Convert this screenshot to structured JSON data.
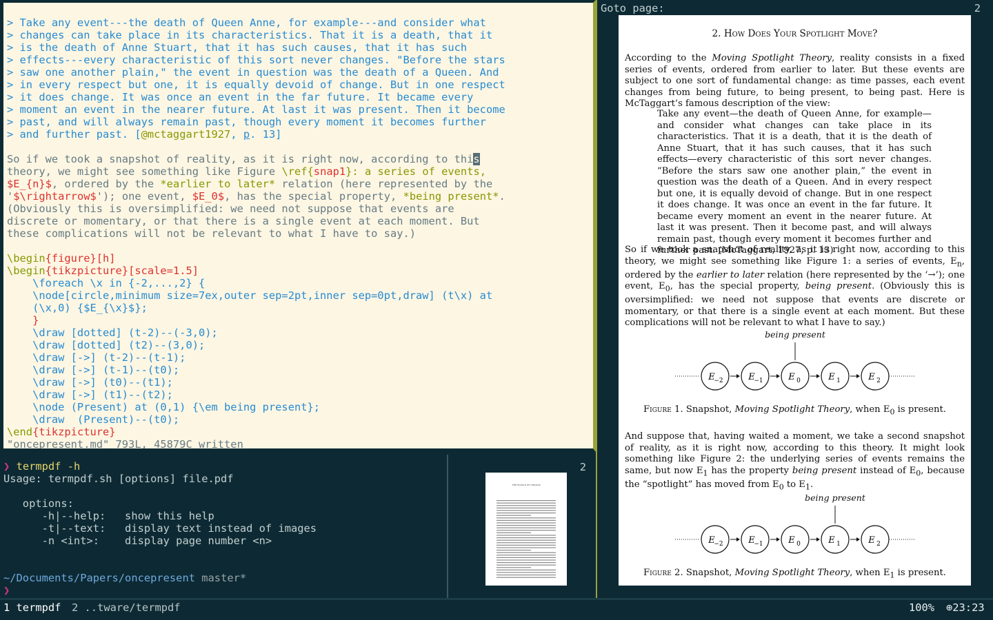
{
  "editor": {
    "quote_lines": [
      "> Take any event---the death of Queen Anne, for example---and consider what",
      "> changes can take place in its characteristics. That it is a death, that it",
      "> is the death of Anne Stuart, that it has such causes, that it has such",
      "> effects---every characteristic of this sort never changes. \"Before the stars",
      "> saw one another plain,\" the event in question was the death of a Queen. And",
      "> in every respect but one, it is equally devoid of change. But in one respect",
      "> it does change. It was once an event in the far future. It became every",
      "> moment an event in the nearer future. At last it was present. Then it become",
      "> past, and will always remain past, though every moment it becomes further"
    ],
    "quote_last_pre": "> and further past. [",
    "quote_last_cite": "@mctaggart1927",
    "quote_last_mid": ", ",
    "quote_last_p": "p",
    "quote_last_post": ". 13]",
    "para1_pre": "So if we took a snapshot of reality, as it is right now, according to thi",
    "para1_cursor": "s",
    "para2_a": "theory, we might see something like Figure ",
    "para2_ref": "\\ref",
    "para2_b": "{",
    "para2_c": "snap1",
    "para2_d": "}: a series of events,",
    "para3_math": "$E_{n}$",
    "para3_a": ", ordered by the ",
    "para3_em": "*earlier to later*",
    "para3_b": " relation (here represented by the",
    "para4_a": "'",
    "para4_math": "$\\rightarrow$",
    "para4_b": "'); one event, ",
    "para4_math2": "$E_0$",
    "para4_c": ", has the special property, ",
    "para4_em": "*being present*",
    "para4_d": ".",
    "para5": "(Obviously this is oversimplified: we need not suppose that events are",
    "para6": "discrete or momentary, or that there is a single event at each moment. But",
    "para7": "these complications will not be relevant to what I have to say.)",
    "begin_figure_cmd": "\\begin",
    "begin_figure_arg": "{figure}",
    "begin_figure_opt": "[h]",
    "begin_tikz_cmd": "\\begin",
    "begin_tikz_arg": "{tikzpicture}",
    "begin_tikz_opt": "[scale=1.5]",
    "foreach_line": "    \\foreach \\x in {-2,...,2} {",
    "node_line": "    \\node[circle,minimum size=7ex,outer sep=2pt,inner sep=0pt,draw] (t\\x) at",
    "node_line2": "    (\\x,0) {$E_{\\x}$};",
    "close_brace": "    }",
    "draw_lines": [
      "    \\draw [dotted] (t-2)--(-3,0);",
      "    \\draw [dotted] (t2)--(3,0);",
      "    \\draw [->] (t-2)--(t-1);",
      "    \\draw [->] (t-1)--(t0);",
      "    \\draw [->] (t0)--(t1);",
      "    \\draw [->] (t1)--(t2);",
      "    \\node (Present) at (0,1) {\\em being present};",
      "    \\draw  (Present)--(t0);"
    ],
    "end_tikz_cmd": "\\end",
    "end_tikz_arg": "{tikzpicture}",
    "status_line": "\"oncepresent.md\" 793L, 45879C written"
  },
  "shell": {
    "prompt_symbol": "❯",
    "command": "termpdf -h",
    "usage": "Usage: termpdf.sh [options] file.pdf",
    "options_header": "   options:",
    "options": [
      "      -h|--help:   show this help",
      "      -t|--text:   display text instead of images",
      "      -n <int>:    display page number <n>"
    ],
    "cwd": "~/Documents/Papers/oncepresent",
    "branch": "master*",
    "prompt2": "❯"
  },
  "thumb_pane": {
    "page_number": "2",
    "thumb_title": "THE PUZZLE OF CHANGE"
  },
  "pdf_viewer": {
    "goto_label": "Goto page:",
    "page_number": "2",
    "section_title": "2. How Does Your Spotlight Move?",
    "intro_a": "According to the ",
    "intro_em": "Moving Spotlight Theory",
    "intro_b": ", reality consists in a fixed series of events, ordered from earlier to later. But these events are subject to one sort of fundamental change: as time passes, each event changes from being future, to being present, to being past. Here is McTaggart’s famous description of the view:",
    "blockquote": "Take any event—the death of Queen Anne, for example—and consider what changes can take place in its characteristics. That it is a death, that it is the death of Anne Stuart, that it has such causes, that it has such effects—every characteristic of this sort never changes. “Before the stars saw one another plain,” the event in question was the death of a Queen. And in every respect but one, it is equally devoid of change. But in one respect it does change. It was once an event in the far future. It became every moment an event in the nearer future. At last it was present. Then it become past, and will always remain past, though every moment it becomes further and further past. (McTaggart, 1927, p. 13)",
    "para2_a": "So if we took a snapshot of reality, as it is right now, according to this theory, we might see something like Figure 1: a series of events, E",
    "para2_sub": "n",
    "para2_b": ", ordered by the ",
    "para2_em": "earlier to later",
    "para2_c": " relation (here represented by the ‘→’); one event, E",
    "para2_sub2": "0",
    "para2_d": ", has the special property, ",
    "para2_em2": "being present",
    "para2_e": ". (Obviously this is oversimplified: we need not suppose that events are discrete or momentary, or that there is a single event at each moment. But these complications will not be relevant to what I have to say.)",
    "being_present": "being present",
    "nodes": [
      "E",
      "E",
      "E",
      "E",
      "E"
    ],
    "node_subs": [
      "−2",
      "−1",
      "0",
      "1",
      "2"
    ],
    "fig1_label": "Figure 1.",
    "fig1_a": " Snapshot, ",
    "fig1_em": "Moving Spotlight Theory",
    "fig1_b": ", when E",
    "fig1_sub": "0",
    "fig1_c": " is present.",
    "para3_a": "And suppose that, having waited a moment, we take a second snapshot of reality, as it is right now, according to this theory. It might look something like Figure 2: the underlying series of events remains the same, but now E",
    "para3_sub": "1",
    "para3_b": " has the property ",
    "para3_em": "being present",
    "para3_c": " instead of E",
    "para3_sub2": "0",
    "para3_d": ", because the “spotlight” has moved from E",
    "para3_sub3": "0",
    "para3_e": " to E",
    "para3_sub4": "1",
    "para3_f": ".",
    "fig2_label": "Figure 2.",
    "fig2_a": " Snapshot, ",
    "fig2_em": "Moving Spotlight Theory",
    "fig2_b": ", when E",
    "fig2_sub": "1",
    "fig2_c": " is present."
  },
  "statusbar": {
    "window1": "1 termpdf",
    "window2": "2 ..tware/termpdf",
    "zoom": "100%",
    "clock": "⊕23:23"
  }
}
